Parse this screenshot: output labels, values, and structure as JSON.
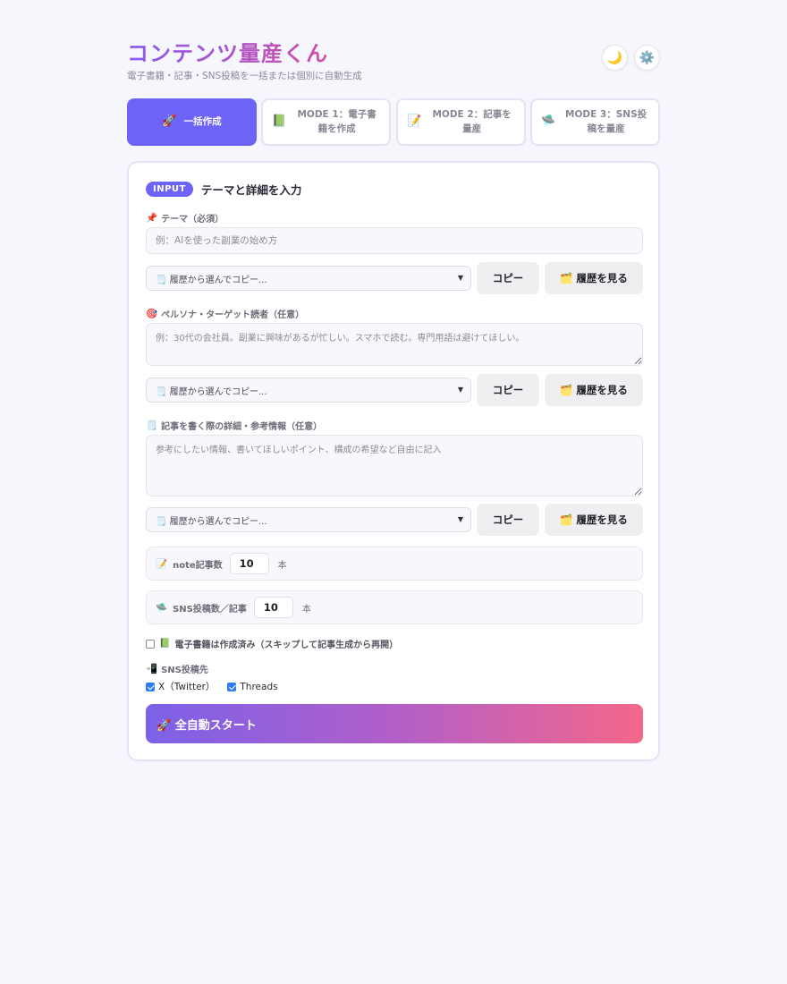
{
  "header": {
    "title": "コンテンツ量産くん",
    "subtitle": "電子書籍・記事・SNS投稿を一括または個別に自動生成",
    "theme_icon": "🌙",
    "settings_icon": "⚙️"
  },
  "tabs": [
    {
      "icon": "🚀",
      "label": "一括作成",
      "active": true
    },
    {
      "icon": "📗",
      "label": "MODE 1：電子書籍を作成"
    },
    {
      "icon": "📝",
      "label": "MODE 2：記事を量産"
    },
    {
      "icon": "🛸",
      "label": "MODE 3：SNS投稿を量産"
    }
  ],
  "card": {
    "badge": "INPUT",
    "title": "テーマと詳細を入力",
    "theme": {
      "icon": "📌",
      "label": "テーマ（必須）",
      "placeholder": "例：AIを使った副業の始め方",
      "value": ""
    },
    "persona": {
      "icon": "🎯",
      "label": "ペルソナ・ターゲット読者（任意）",
      "placeholder": "例：30代の会社員。副業に興味があるが忙しい。スマホで読む。専門用語は避けてほしい。",
      "value": ""
    },
    "details": {
      "icon": "🗒️",
      "label": "記事を書く際の詳細・参考情報（任意）",
      "placeholder": "参考にしたい情報、書いてほしいポイント、構成の希望など自由に記入",
      "value": ""
    },
    "history_select": "🗒️ 履歴から選んでコピー...",
    "copy_label": "コピー",
    "view_history_label": "🗂️ 履歴を見る",
    "note_count": {
      "icon": "📝",
      "label": "note記事数",
      "value": "10",
      "unit": "本"
    },
    "sns_count": {
      "icon": "🛸",
      "label": "SNS投稿数／記事",
      "value": "10",
      "unit": "本"
    },
    "ebook_done": {
      "icon": "📗",
      "label": "電子書籍は作成済み（スキップして記事生成から再開）",
      "checked": false
    },
    "sns_targets": {
      "icon": "📲",
      "label": "SNS投稿先",
      "options": [
        {
          "label": "X（Twitter）",
          "checked": true
        },
        {
          "label": "Threads",
          "checked": true
        }
      ]
    },
    "start_label": "🚀 全自動スタート"
  }
}
